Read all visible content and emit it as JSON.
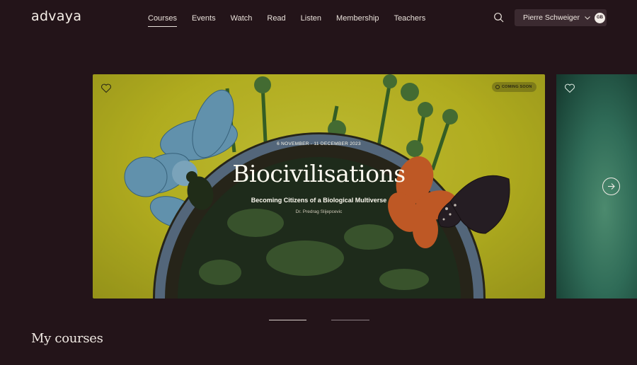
{
  "header": {
    "logo": "advaya",
    "nav": [
      {
        "label": "Courses",
        "active": true
      },
      {
        "label": "Events"
      },
      {
        "label": "Watch"
      },
      {
        "label": "Read"
      },
      {
        "label": "Listen"
      },
      {
        "label": "Membership"
      },
      {
        "label": "Teachers"
      }
    ],
    "search_icon": "search-icon",
    "user": {
      "name": "Pierre Schweiger",
      "avatar_initials": "GB"
    }
  },
  "featured": {
    "badge": "COMING SOON",
    "date": "6 NOVEMBER - 11 DECEMBER 2023",
    "title": "Biocivilisations",
    "subtitle": "Becoming Citizens of a Biological Multiverse",
    "teacher": "Dr. Predrag Slijepcevic"
  },
  "carousel": {
    "slides": 2,
    "active": 1
  },
  "sections": {
    "my_courses": "My courses"
  },
  "colors": {
    "background": "#231419",
    "hero_yellow": "#c9c424",
    "accent_light": "#f2ece6"
  }
}
